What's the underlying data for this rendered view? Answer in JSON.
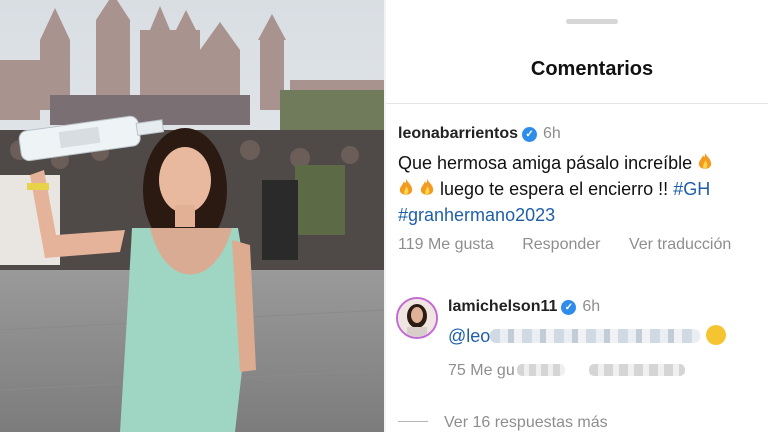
{
  "screen": {
    "left_photo": {
      "subject": "woman holding bottle at festival",
      "accent_colors": {
        "dress": "#9fd6c3",
        "sky": "#dfe4e8",
        "castle": "#b7a6a2"
      }
    },
    "comments_panel": {
      "title": "Comentarios",
      "comments": [
        {
          "username": "leonabarrientos",
          "verified_icon": "verified-badge-icon",
          "time": "6h",
          "text_line1": "Que hermosa amiga pásalo increíble",
          "text_line2_plain": "luego te espera el encierro !!",
          "hashtag1": "#GH",
          "hashtag2": "#granhermano2023",
          "emoji_icons": [
            "fire-icon",
            "fire-icon",
            "fire-icon"
          ],
          "likes": "119 Me gusta",
          "reply_label": "Responder",
          "translate_label": "Ver traducción"
        },
        {
          "username": "lamichelson11",
          "verified_icon": "verified-badge-icon",
          "time": "6h",
          "text_visible": "@leo",
          "emoji_icon": "smiling-face-icon",
          "likes_visible": "75 Me gu",
          "view_replies": "Ver 16 respuestas más"
        }
      ]
    }
  }
}
